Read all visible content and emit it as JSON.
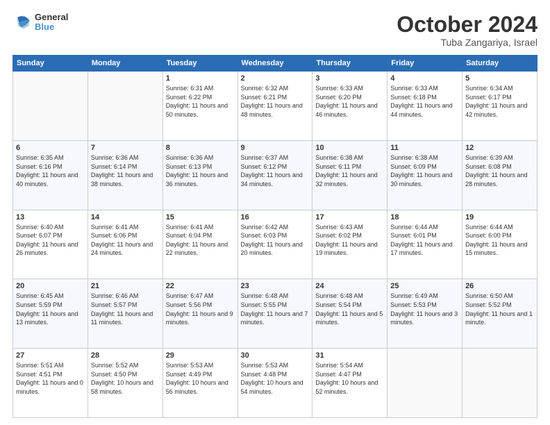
{
  "header": {
    "logo_general": "General",
    "logo_blue": "Blue",
    "month_year": "October 2024",
    "location": "Tuba Zangariya, Israel"
  },
  "days_of_week": [
    "Sunday",
    "Monday",
    "Tuesday",
    "Wednesday",
    "Thursday",
    "Friday",
    "Saturday"
  ],
  "weeks": [
    [
      {
        "day": "",
        "info": ""
      },
      {
        "day": "",
        "info": ""
      },
      {
        "day": "1",
        "info": "Sunrise: 6:31 AM\nSunset: 6:22 PM\nDaylight: 11 hours and 50 minutes."
      },
      {
        "day": "2",
        "info": "Sunrise: 6:32 AM\nSunset: 6:21 PM\nDaylight: 11 hours and 48 minutes."
      },
      {
        "day": "3",
        "info": "Sunrise: 6:33 AM\nSunset: 6:20 PM\nDaylight: 11 hours and 46 minutes."
      },
      {
        "day": "4",
        "info": "Sunrise: 6:33 AM\nSunset: 6:18 PM\nDaylight: 11 hours and 44 minutes."
      },
      {
        "day": "5",
        "info": "Sunrise: 6:34 AM\nSunset: 6:17 PM\nDaylight: 11 hours and 42 minutes."
      }
    ],
    [
      {
        "day": "6",
        "info": "Sunrise: 6:35 AM\nSunset: 6:16 PM\nDaylight: 11 hours and 40 minutes."
      },
      {
        "day": "7",
        "info": "Sunrise: 6:36 AM\nSunset: 6:14 PM\nDaylight: 11 hours and 38 minutes."
      },
      {
        "day": "8",
        "info": "Sunrise: 6:36 AM\nSunset: 6:13 PM\nDaylight: 11 hours and 36 minutes."
      },
      {
        "day": "9",
        "info": "Sunrise: 6:37 AM\nSunset: 6:12 PM\nDaylight: 11 hours and 34 minutes."
      },
      {
        "day": "10",
        "info": "Sunrise: 6:38 AM\nSunset: 6:11 PM\nDaylight: 11 hours and 32 minutes."
      },
      {
        "day": "11",
        "info": "Sunrise: 6:38 AM\nSunset: 6:09 PM\nDaylight: 11 hours and 30 minutes."
      },
      {
        "day": "12",
        "info": "Sunrise: 6:39 AM\nSunset: 6:08 PM\nDaylight: 11 hours and 28 minutes."
      }
    ],
    [
      {
        "day": "13",
        "info": "Sunrise: 6:40 AM\nSunset: 6:07 PM\nDaylight: 11 hours and 26 minutes."
      },
      {
        "day": "14",
        "info": "Sunrise: 6:41 AM\nSunset: 6:06 PM\nDaylight: 11 hours and 24 minutes."
      },
      {
        "day": "15",
        "info": "Sunrise: 6:41 AM\nSunset: 6:04 PM\nDaylight: 11 hours and 22 minutes."
      },
      {
        "day": "16",
        "info": "Sunrise: 6:42 AM\nSunset: 6:03 PM\nDaylight: 11 hours and 20 minutes."
      },
      {
        "day": "17",
        "info": "Sunrise: 6:43 AM\nSunset: 6:02 PM\nDaylight: 11 hours and 19 minutes."
      },
      {
        "day": "18",
        "info": "Sunrise: 6:44 AM\nSunset: 6:01 PM\nDaylight: 11 hours and 17 minutes."
      },
      {
        "day": "19",
        "info": "Sunrise: 6:44 AM\nSunset: 6:00 PM\nDaylight: 11 hours and 15 minutes."
      }
    ],
    [
      {
        "day": "20",
        "info": "Sunrise: 6:45 AM\nSunset: 5:59 PM\nDaylight: 11 hours and 13 minutes."
      },
      {
        "day": "21",
        "info": "Sunrise: 6:46 AM\nSunset: 5:57 PM\nDaylight: 11 hours and 11 minutes."
      },
      {
        "day": "22",
        "info": "Sunrise: 6:47 AM\nSunset: 5:56 PM\nDaylight: 11 hours and 9 minutes."
      },
      {
        "day": "23",
        "info": "Sunrise: 6:48 AM\nSunset: 5:55 PM\nDaylight: 11 hours and 7 minutes."
      },
      {
        "day": "24",
        "info": "Sunrise: 6:48 AM\nSunset: 5:54 PM\nDaylight: 11 hours and 5 minutes."
      },
      {
        "day": "25",
        "info": "Sunrise: 6:49 AM\nSunset: 5:53 PM\nDaylight: 11 hours and 3 minutes."
      },
      {
        "day": "26",
        "info": "Sunrise: 6:50 AM\nSunset: 5:52 PM\nDaylight: 11 hours and 1 minute."
      }
    ],
    [
      {
        "day": "27",
        "info": "Sunrise: 5:51 AM\nSunset: 4:51 PM\nDaylight: 11 hours and 0 minutes."
      },
      {
        "day": "28",
        "info": "Sunrise: 5:52 AM\nSunset: 4:50 PM\nDaylight: 10 hours and 58 minutes."
      },
      {
        "day": "29",
        "info": "Sunrise: 5:53 AM\nSunset: 4:49 PM\nDaylight: 10 hours and 56 minutes."
      },
      {
        "day": "30",
        "info": "Sunrise: 5:53 AM\nSunset: 4:48 PM\nDaylight: 10 hours and 54 minutes."
      },
      {
        "day": "31",
        "info": "Sunrise: 5:54 AM\nSunset: 4:47 PM\nDaylight: 10 hours and 52 minutes."
      },
      {
        "day": "",
        "info": ""
      },
      {
        "day": "",
        "info": ""
      }
    ]
  ]
}
